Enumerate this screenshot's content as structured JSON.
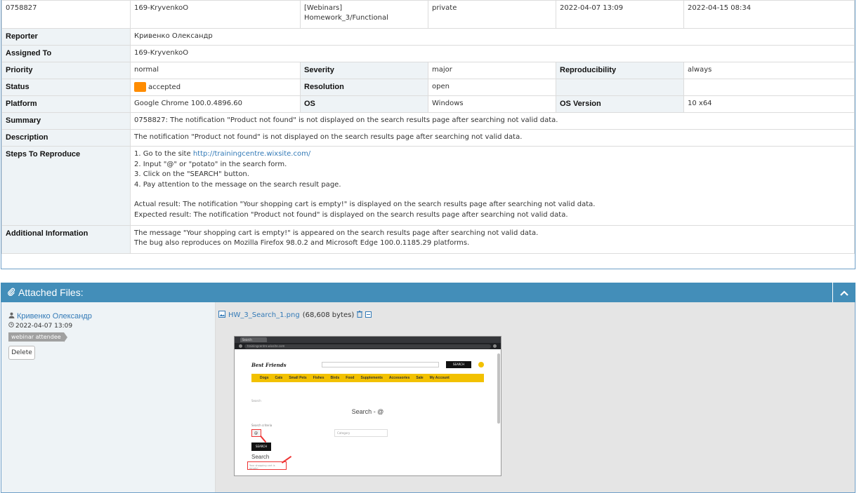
{
  "top_row": {
    "id": "0758827",
    "project_user": "169-KryvenkoO",
    "category": "[Webinars] Homework_3/Functional",
    "view_status": "private",
    "date_submitted": "2022-04-07 13:09",
    "last_update": "2022-04-15 08:34"
  },
  "fields": {
    "reporter_label": "Reporter",
    "reporter_value": "Кривенко Олександр",
    "assigned_label": "Assigned To",
    "assigned_value": "169-KryvenkoO",
    "priority_label": "Priority",
    "priority_value": "normal",
    "severity_label": "Severity",
    "severity_value": "major",
    "reproducibility_label": "Reproducibility",
    "reproducibility_value": "always",
    "status_label": "Status",
    "status_value": "accepted",
    "status_color": "#ff8c00",
    "resolution_label": "Resolution",
    "resolution_value": "open",
    "platform_label": "Platform",
    "platform_value": "Google Chrome 100.0.4896.60",
    "os_label": "OS",
    "os_value": "Windows",
    "os_version_label": "OS Version",
    "os_version_value": "10 x64",
    "summary_label": "Summary",
    "summary_value": "0758827: The notification \"Product not found\" is not displayed on the search results page after searching not valid data.",
    "description_label": "Description",
    "description_value": "The notification \"Product not found\" is not displayed on the search results page after searching not valid data.",
    "steps_label": "Steps To Reproduce",
    "steps": {
      "step1_prefix": "1. Go to the site ",
      "step1_link": "http://trainingcentre.wixsite.com/",
      "step2": "2. Input \"@\" or \"potato\" in the search form.",
      "step3": "3. Click on the \"SEARCH\" button.",
      "step4": "4. Pay attention to the message on the search result page.",
      "actual": "Actual result: The notification \"Your shopping cart is empty!\" is displayed on the search results page after searching not valid data.",
      "expected": "Expected result: The notification \"Product not found\" is displayed on the search results page after searching not valid data."
    },
    "additional_label": "Additional Information",
    "additional_line1": "The message \"Your shopping cart is empty!\" is appeared on the search results page after searching not valid data.",
    "additional_line2": "The bug also reproduces on Mozilla Firefox 98.0.2 and Microsoft Edge 100.0.1185.29 platforms."
  },
  "attachments": {
    "header_title": "Attached Files:",
    "author": "Кривенко Олександр",
    "date": "2022-04-07 13:09",
    "role_tag": "webinar attendee",
    "delete_label": "Delete",
    "file_name": "HW_3_Search_1.png",
    "file_size": "(68,608 bytes)",
    "accent_color": "#438eb9"
  },
  "thumbnail": {
    "tab_title": "Search",
    "url": "trainingcentre.wixsite.com",
    "logo": "Best Friends",
    "search_button": "SEARCH",
    "menu_items": [
      "Dogs",
      "Cats",
      "Small Pets",
      "Fishes",
      "Birds",
      "Food",
      "Supplements",
      "Accessories",
      "Sale",
      "My Account"
    ],
    "crumb": "Search",
    "page_title": "Search - @",
    "criteria_label": "Search criteria",
    "criteria_value": "@",
    "category_select": "Category",
    "search_big": "SEARCH",
    "results_heading": "Search",
    "empty_message": "Your shopping cart is empty!"
  }
}
